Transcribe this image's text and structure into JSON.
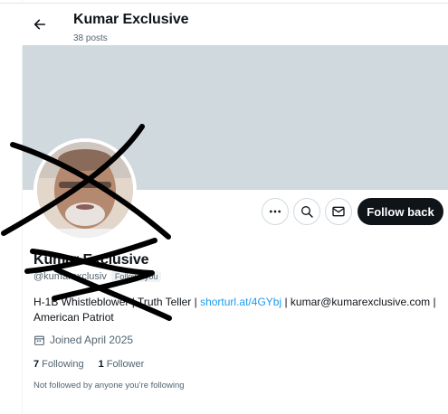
{
  "header": {
    "title": "Kumar Exclusive",
    "post_count": "38 posts",
    "back_icon": "arrow-left-icon"
  },
  "profile": {
    "name": "Kumar Exclusive",
    "handle": "@kumarexclusiv",
    "follows_you_badge": "Follows you",
    "bio_text_1": "H-1B Whistleblower | Truth Teller | ",
    "bio_link": "shorturl.at/4GYbj",
    "bio_text_2": " | kumar@kumarexclusive.com | American Patriot",
    "joined": "Joined April 2025",
    "following_count": "7",
    "following_label": "Following",
    "followers_count": "1",
    "followers_label": "Follower",
    "not_followed_note": "Not followed by anyone you're following"
  },
  "actions": {
    "more_icon": "more-icon",
    "search_icon": "search-icon",
    "message_icon": "mail-icon",
    "follow_label": "Follow back"
  },
  "colors": {
    "banner": "#cfd9de",
    "link": "#1d9bf0",
    "follow_button": "#0f1419",
    "secondary_text": "#536471"
  }
}
